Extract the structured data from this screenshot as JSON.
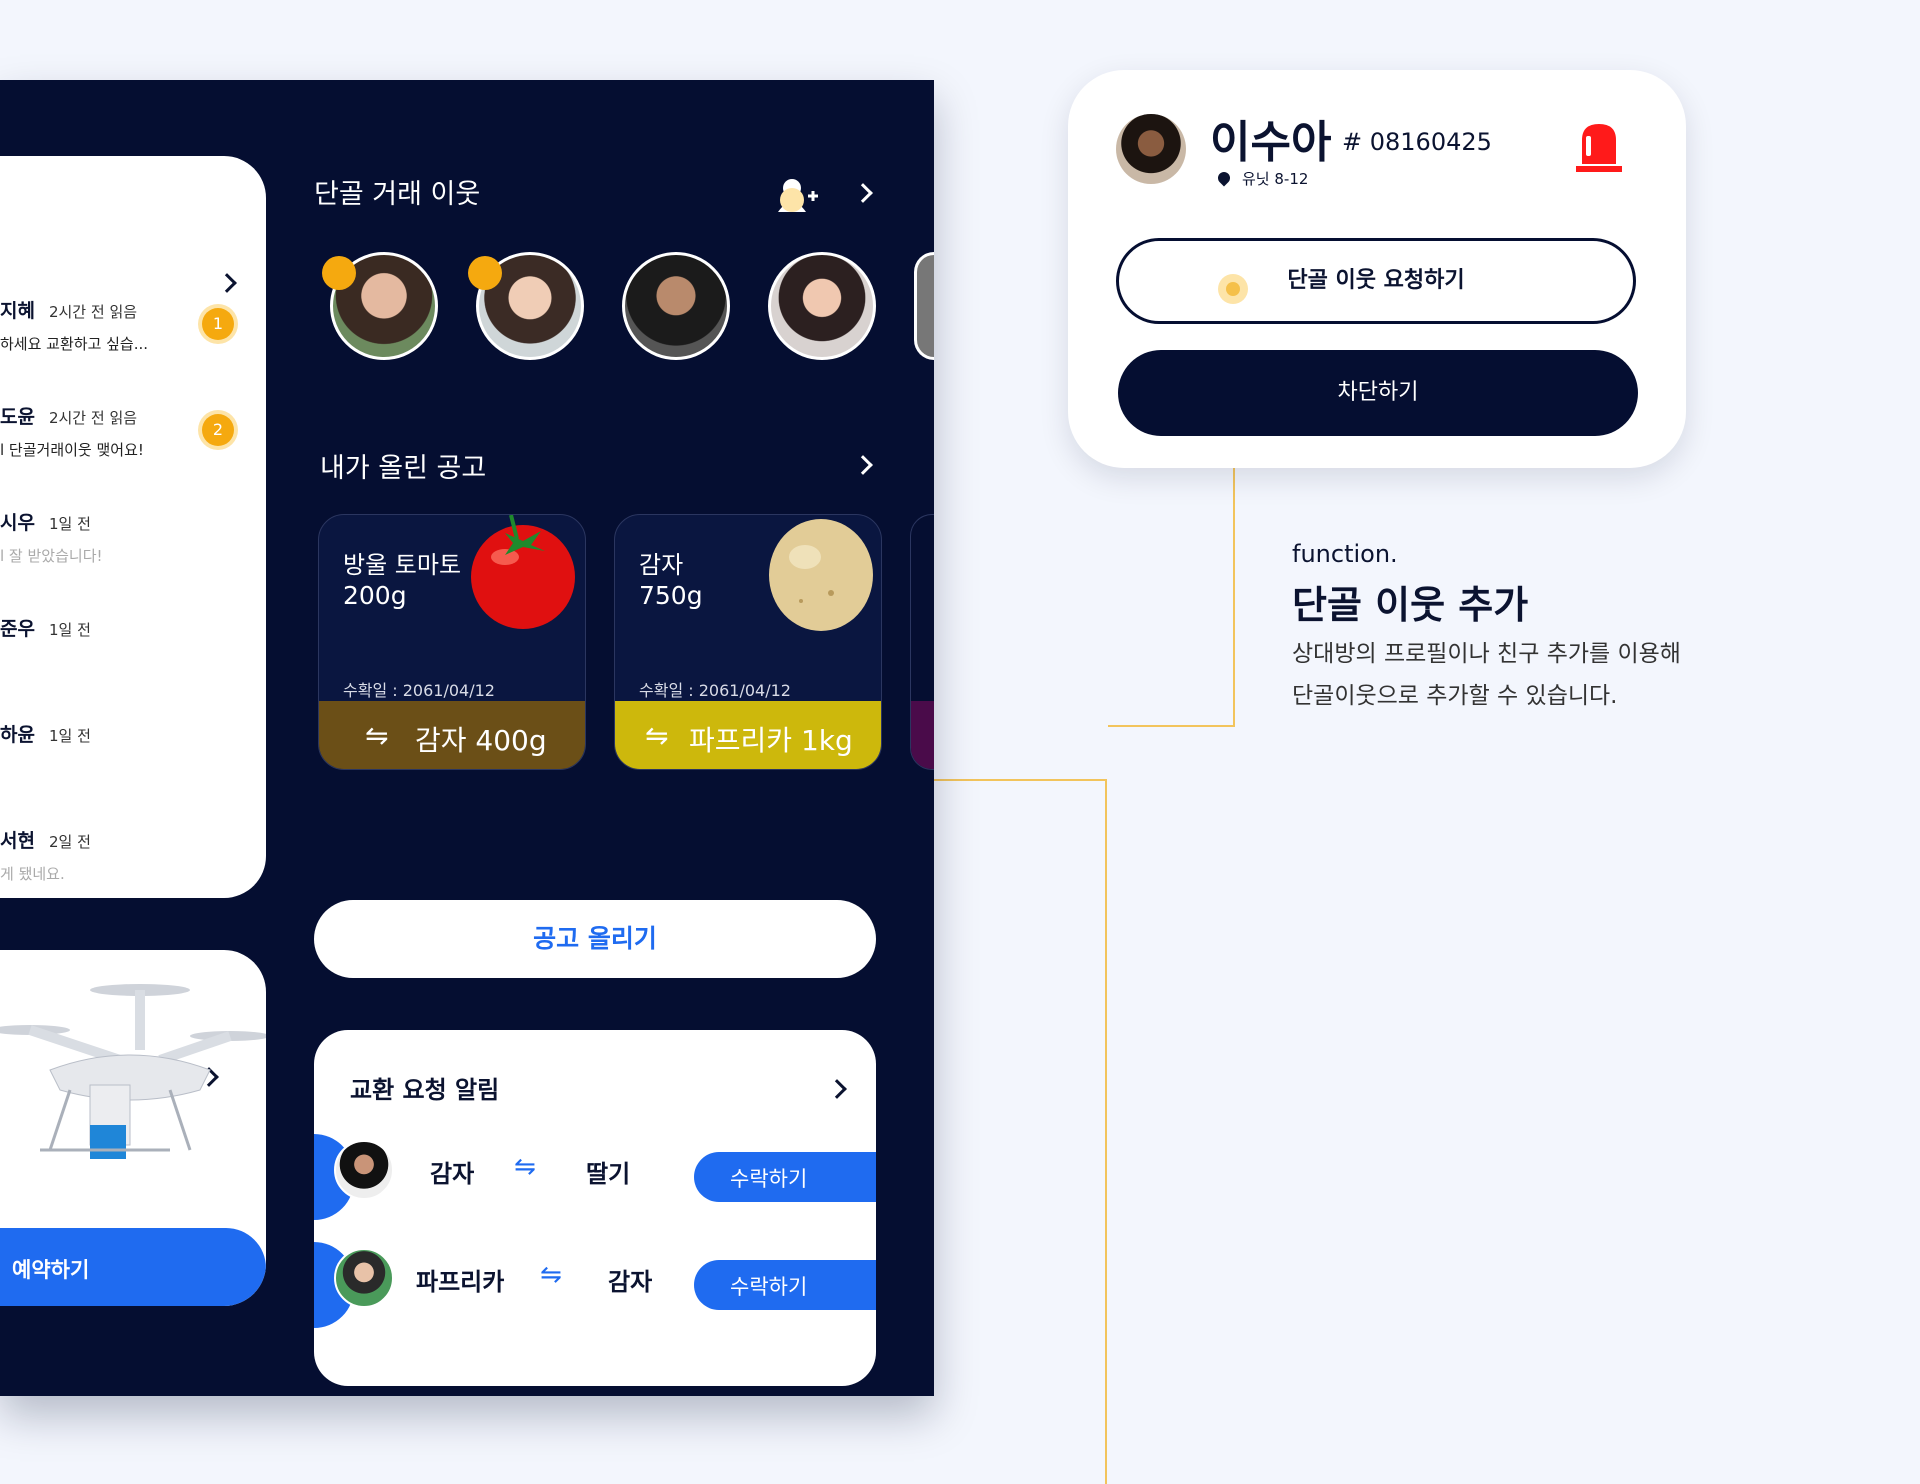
{
  "messages": {
    "items": [
      {
        "name": "지혜",
        "time": "2시간 전 읽음",
        "preview": "하세요 교환하고 싶습...",
        "badge": "1",
        "dim": false
      },
      {
        "name": "도윤",
        "time": "2시간 전 읽음",
        "preview": "l 단골거래이웃 맺어요!",
        "badge": "2",
        "dim": false
      },
      {
        "name": "시우",
        "time": "1일 전",
        "preview": "l 잘 받았습니다!",
        "badge": "",
        "dim": true
      },
      {
        "name": "준우",
        "time": "1일 전",
        "preview": "",
        "badge": "",
        "dim": false
      },
      {
        "name": "하윤",
        "time": "1일 전",
        "preview": "",
        "badge": "",
        "dim": false
      },
      {
        "name": "서현",
        "time": "2일 전",
        "preview": "게 됐네요.",
        "badge": "",
        "dim": true
      }
    ]
  },
  "drone": {
    "reserve_label": "예약하기"
  },
  "neighbors": {
    "title": "단골 거래 이웃"
  },
  "my_posts": {
    "title": "내가 올린 공고",
    "items": [
      {
        "name": "방울 토마토",
        "weight": "200g",
        "date": "수확일 : 2061/04/12",
        "exchange": "감자 400g",
        "bar_color": "#6b4f17"
      },
      {
        "name": "감자",
        "weight": "750g",
        "date": "수확일 : 2061/04/12",
        "exchange": "파프리카 1kg",
        "bar_color": "#cdb80c"
      }
    ]
  },
  "post_button": "공고 올리기",
  "requests": {
    "title": "교환 요청 알림",
    "items": [
      {
        "give": "감자",
        "get": "딸기",
        "accept": "수락하기"
      },
      {
        "give": "파프리카",
        "get": "감자",
        "accept": "수락하기"
      }
    ]
  },
  "profile": {
    "name": "이수아",
    "id": "# 08160425",
    "location": "유닛 8-12",
    "request_button": "단골 이웃 요청하기",
    "block_button": "차단하기"
  },
  "annotation": {
    "label": "function.",
    "title": "단골 이웃 추가",
    "desc_line1": "상대방의 프로필이나 친구 추가를 이용해",
    "desc_line2": "단골이웃으로 추가할 수 있습니다."
  },
  "colors": {
    "accent": "#1f6bf0",
    "navy": "#050e31",
    "badge": "#f5a90f",
    "alert": "#ff1a1a"
  }
}
